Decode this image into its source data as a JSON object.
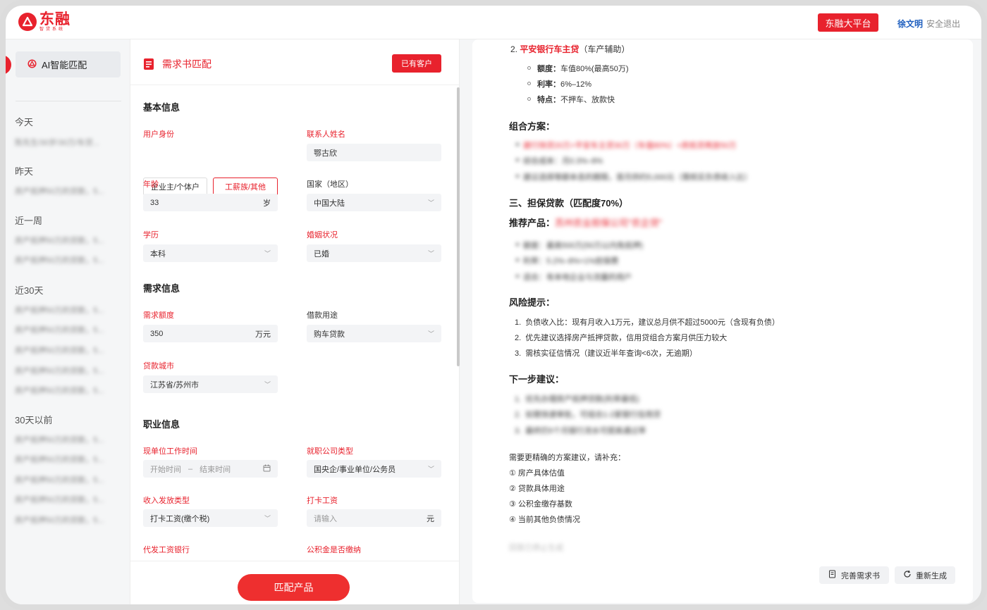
{
  "brand": {
    "mark": "东",
    "name": "东融",
    "sub": "智贷系统"
  },
  "header": {
    "platform_label": "东融大平台",
    "user_name": "徐文明",
    "logout_label": "安全退出"
  },
  "sidebar": {
    "ai_match_label": "AI智能匹配",
    "groups": [
      {
        "label": "今天",
        "items": [
          "陈先生/30岁/30万/车贷..."
        ]
      },
      {
        "label": "昨天",
        "items": [
          "房产抵押50万的贷款，5..."
        ]
      },
      {
        "label": "近一周",
        "items": [
          "房产抵押50万的贷款，5...",
          "房产抵押50万的贷款，5..."
        ]
      },
      {
        "label": "近30天",
        "items": [
          "房产抵押50万的贷款，5...",
          "房产抵押50万的贷款，5...",
          "房产抵押50万的贷款，5...",
          "房产抵押50万的贷款，5...",
          "房产抵押50万的贷款，5..."
        ]
      },
      {
        "label": "30天以前",
        "items": [
          "房产抵押50万的贷款，5...",
          "房产抵押50万的贷款，5...",
          "房产抵押50万的贷款，5...",
          "房产抵押50万的贷款，5...",
          "房产抵押50万的贷款，5..."
        ]
      }
    ]
  },
  "form": {
    "title": "需求书匹配",
    "existing_client_label": "已有客户",
    "basic": {
      "title": "基本信息",
      "identity_label": "用户身份",
      "identity_options": [
        "企业主/个体户",
        "工薪族/其他"
      ],
      "identity_selected": "工薪族/其他",
      "contact_label": "联系人姓名",
      "contact_value": "鄂古欣",
      "age_label": "年龄",
      "age_value": "33",
      "age_unit": "岁",
      "country_label": "国家（地区）",
      "country_value": "中国大陆",
      "education_label": "学历",
      "education_value": "本科",
      "marital_label": "婚姻状况",
      "marital_value": "已婚"
    },
    "demand": {
      "title": "需求信息",
      "amount_label": "需求额度",
      "amount_value": "350",
      "amount_unit": "万元",
      "purpose_label": "借款用途",
      "purpose_value": "购车贷款",
      "city_label": "贷款城市",
      "city_value": "江苏省/苏州市"
    },
    "job": {
      "title": "职业信息",
      "work_time_label": "现单位工作时间",
      "start_placeholder": "开始时间",
      "range_sep": "–",
      "end_placeholder": "结束时间",
      "company_type_label": "就职公司类型",
      "company_type_value": "国央企/事业单位/公务员",
      "income_type_label": "收入发放类型",
      "income_type_value": "打卡工资(缴个税)",
      "salary_label": "打卡工资",
      "salary_placeholder": "请输入",
      "salary_unit": "元",
      "bank_label": "代发工资银行",
      "fund_label": "公积金是否缴纳"
    },
    "submit_label": "匹配产品"
  },
  "result": {
    "item2_num": "2.",
    "item2_name": "平安银行车主贷",
    "item2_note": "（车产辅助）",
    "item2_bullets": [
      {
        "k": "额度：",
        "v": "车值80%(最高50万)"
      },
      {
        "k": "利率：",
        "v": "6%–12%"
      },
      {
        "k": "特点：",
        "v": "不押车、放款快"
      }
    ],
    "combo_title": "组合方案：",
    "combo_items": [
      "建行快贷20万+平安车主贷30万（车值80%）+房抵贷再放50万",
      "综合成本：月0.3%–8%",
      "建议选择等额本息的期限，首月供约5,000元（需核实负债收入比）"
    ],
    "guarantee_title": "三、担保贷款（匹配度70%）",
    "recommend_label": "推荐产品：",
    "recommend_name": "苏州农业担保公司\"农企贷\"",
    "guarantee_items": [
      "额度：最高500万(50万以内免抵押)",
      "利率：5.2%–8%+1%担保费",
      "适合：有本地企业与流量的用户"
    ],
    "risk_title": "风险提示：",
    "risk_items": [
      "负债收入比：现有月收入1万元，建议总月供不超过5000元（含现有负债）",
      "优先建议选择房产抵押贷款，信用贷组合方案月供压力较大",
      "需核实征信情况（建议近半年查询<6次，无逾期）"
    ],
    "next_title": "下一步建议：",
    "next_items": [
      "优先办理房产抵押贷款(利率最低)",
      "如需快速审批，可组合1-2家银行信用贷",
      "最终仍5个月银行流水可提高通过率"
    ],
    "supplement_intro": "需要更精确的方案建议，请补充：",
    "supplement_items": [
      "① 房产具体估值",
      "② 贷款具体用途",
      "③ 公积金缴存基数",
      "④ 当前其他负债情况"
    ],
    "blurred_footer": "回答已停止生成",
    "complete_btn": "完善需求书",
    "regen_btn": "重新生成"
  }
}
